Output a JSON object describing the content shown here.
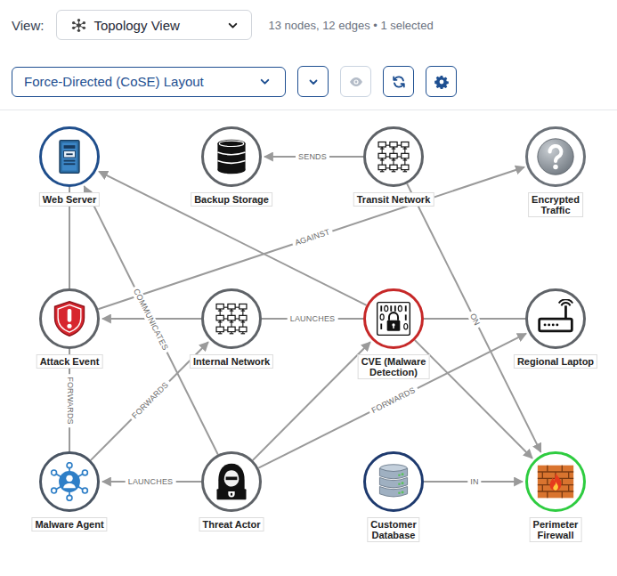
{
  "toolbar": {
    "view_label": "View:",
    "view": "Topology View",
    "summary": "13 nodes, 12 edges • 1 selected",
    "layout": "Force-Directed (CoSE) Layout",
    "buttons": [
      {
        "kind": "chevron",
        "disabled": false
      },
      {
        "kind": "eye",
        "disabled": true
      },
      {
        "kind": "refresh",
        "disabled": false
      },
      {
        "kind": "gear",
        "disabled": false
      }
    ]
  },
  "graph": {
    "nodes": [
      {
        "label": "Web Server",
        "kind": "server",
        "color": "#1f4e8c"
      },
      {
        "label": "Backup Storage",
        "kind": "storage",
        "color": "#5f6368"
      },
      {
        "label": "Transit Network",
        "kind": "network",
        "color": "#5f6368"
      },
      {
        "label": "Encrypted\nTraffic",
        "kind": "unknown",
        "color": "#6b7178"
      },
      {
        "label": "Attack Event",
        "kind": "alert",
        "color": "#5f6368"
      },
      {
        "label": "Internal Network",
        "kind": "network",
        "color": "#5f6368"
      },
      {
        "label": "CVE (Malware\nDetection)",
        "kind": "vulnerability",
        "color": "#c62828"
      },
      {
        "label": "Regional Laptop",
        "kind": "router",
        "color": "#5f6368"
      },
      {
        "label": "Malware Agent",
        "kind": "agent",
        "color": "#4a5563"
      },
      {
        "label": "Threat Actor",
        "kind": "actor",
        "color": "#5f6368"
      },
      {
        "label": "Customer\nDatabase",
        "kind": "database",
        "color": "#1e3a6e"
      },
      {
        "label": "Perimeter\nFirewall",
        "kind": "firewall",
        "color": "#2ecc40"
      }
    ],
    "edges": [
      {
        "from": "Transit Network",
        "to": "Backup Storage",
        "label": "SENDS",
        "arrow": true
      },
      {
        "from": "Attack Event",
        "to": "Encrypted\nTraffic",
        "label": "AGAINST",
        "arrow": true
      },
      {
        "from": "CVE (Malware\nDetection)",
        "to": "Internal Network",
        "label": "LAUNCHES",
        "arrow": false
      },
      {
        "from": "Internal Network",
        "to": "Attack Event",
        "arrow": true
      },
      {
        "from": "Transit Network",
        "to": "Perimeter\nFirewall",
        "label": "ON",
        "arrow": true
      },
      {
        "from": "CVE (Malware\nDetection)",
        "to": "Regional Laptop",
        "arrow": false
      },
      {
        "from": "Web Server",
        "to": "Attack Event",
        "arrow": false
      },
      {
        "from": "Attack Event",
        "to": "Malware Agent",
        "label": "FORWARDS",
        "arrow": false
      },
      {
        "from": "Threat Actor",
        "to": "Web Server",
        "label": "COMMUNICATES",
        "arrow": true
      },
      {
        "from": "Threat Actor",
        "to": "Malware Agent",
        "label": "LAUNCHES",
        "arrow": true
      },
      {
        "from": "Malware Agent",
        "to": "Internal Network",
        "label": "FORWARDS",
        "arrow": true
      },
      {
        "from": "Threat Actor",
        "to": "CVE (Malware\nDetection)",
        "arrow": true
      },
      {
        "from": "Threat Actor",
        "to": "Regional Laptop",
        "label": "FORWARDS",
        "arrow": true
      },
      {
        "from": "Customer\nDatabase",
        "to": "Perimeter\nFirewall",
        "label": "IN",
        "arrow": true
      },
      {
        "from": "CVE (Malware\nDetection)",
        "to": "Web Server",
        "arrow": true
      },
      {
        "from": "CVE (Malware\nDetection)",
        "to": "Perimeter\nFirewall",
        "arrow": true
      }
    ]
  }
}
